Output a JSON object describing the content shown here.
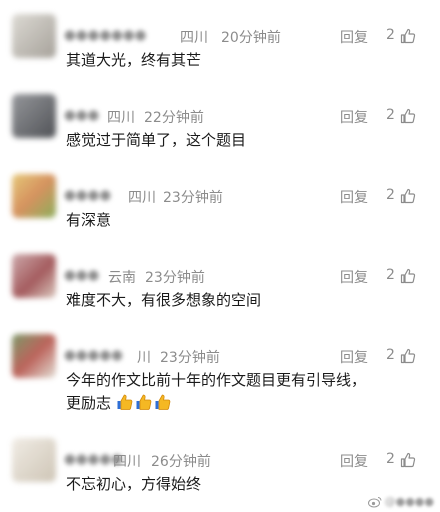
{
  "comments": [
    {
      "location": "四川",
      "time": "20分钟前",
      "reply": "回复",
      "likes": "2",
      "text": "其道大光，终有其芒"
    },
    {
      "location": "四川",
      "time": "22分钟前",
      "reply": "回复",
      "likes": "2",
      "text": "感觉过于简单了，这个题目"
    },
    {
      "location": "四川",
      "time": "23分钟前",
      "reply": "回复",
      "likes": "2",
      "text": "有深意"
    },
    {
      "location": "云南",
      "time": "23分钟前",
      "reply": "回复",
      "likes": "2",
      "text": "难度不大，有很多想象的空间"
    },
    {
      "location": "川",
      "time": "23分钟前",
      "reply": "回复",
      "likes": "2",
      "text": "今年的作文比前十年的作文题目更有引导线，",
      "text2": "更励志"
    },
    {
      "location": "四川",
      "time": "26分钟前",
      "reply": "回复",
      "likes": "2",
      "text": "不忘初心，方得始终"
    }
  ],
  "icons": {
    "like": "thumbs-up-icon",
    "emoji": "thumbs-up-emoji"
  },
  "colors": {
    "meta": "#8c8c8c",
    "text": "#1a1a1a"
  }
}
